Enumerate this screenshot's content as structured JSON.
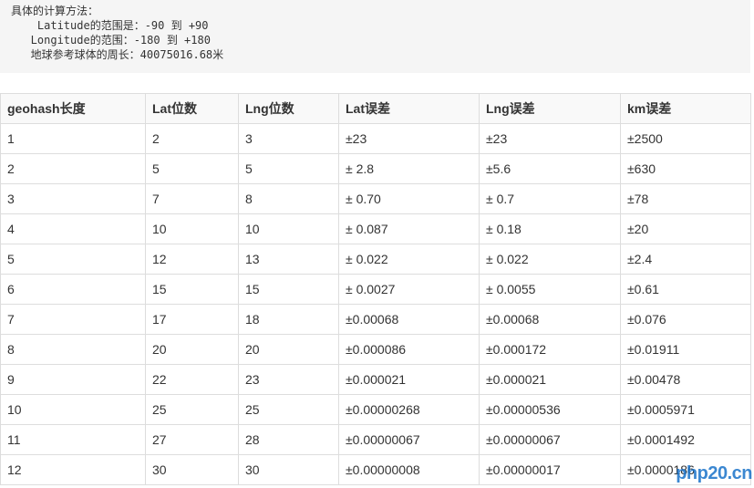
{
  "code": {
    "lines": [
      "具体的计算方法：",
      "    Latitude的范围是：-90 到 +90",
      "   Longitude的范围：-180 到 +180",
      "   地球参考球体的周长：40075016.68米"
    ]
  },
  "table": {
    "headers": [
      "geohash长度",
      "Lat位数",
      "Lng位数",
      "Lat误差",
      "Lng误差",
      "km误差"
    ],
    "rows": [
      [
        "1",
        "2",
        "3",
        "±23",
        "±23",
        "±2500"
      ],
      [
        "2",
        "5",
        "5",
        "± 2.8",
        "±5.6",
        "±630"
      ],
      [
        "3",
        "7",
        "8",
        "± 0.70",
        "± 0.7",
        "±78"
      ],
      [
        "4",
        "10",
        "10",
        "± 0.087",
        "± 0.18",
        "±20"
      ],
      [
        "5",
        "12",
        "13",
        "± 0.022",
        "± 0.022",
        "±2.4"
      ],
      [
        "6",
        "15",
        "15",
        "± 0.0027",
        "± 0.0055",
        "±0.61"
      ],
      [
        "7",
        "17",
        "18",
        "±0.00068",
        "±0.00068",
        "±0.076"
      ],
      [
        "8",
        "20",
        "20",
        "±0.000086",
        "±0.000172",
        "±0.01911"
      ],
      [
        "9",
        "22",
        "23",
        "±0.000021",
        "±0.000021",
        "±0.00478"
      ],
      [
        "10",
        "25",
        "25",
        "±0.00000268",
        "±0.00000536",
        "±0.0005971"
      ],
      [
        "11",
        "27",
        "28",
        "±0.00000067",
        "±0.00000067",
        "±0.0001492"
      ],
      [
        "12",
        "30",
        "30",
        "±0.00000008",
        "±0.00000017",
        "±0.0000186"
      ]
    ]
  },
  "watermark": {
    "text": "php20.cn"
  }
}
